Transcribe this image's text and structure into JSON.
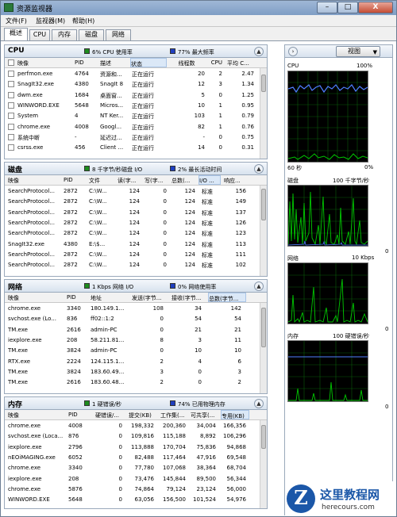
{
  "window": {
    "title": "资源监视器",
    "min": "–",
    "max": "□",
    "close": "X"
  },
  "menu": [
    "文件(F)",
    "监视器(M)",
    "帮助(H)"
  ],
  "tabs": [
    "概述",
    "CPU",
    "内存",
    "磁盘",
    "网络"
  ],
  "colors": {
    "green": "#1e8c1e",
    "blue": "#1f3fbf",
    "graph_green": "#00c800",
    "graph_blue": "#4f7fff"
  },
  "cpu": {
    "title": "CPU",
    "stat1": "6% CPU 使用率",
    "stat2": "77% 最大频率",
    "headers": [
      "映像",
      "PID",
      "描述",
      "状态",
      "线程数",
      "CPU",
      "平均 C..."
    ],
    "rows": [
      [
        "perfmon.exe",
        "4764",
        "资源和...",
        "正在运行",
        "20",
        "2",
        "2.47"
      ],
      [
        "SnagIt32.exe",
        "4380",
        "SnagIt 8",
        "正在运行",
        "12",
        "3",
        "1.34"
      ],
      [
        "dwm.exe",
        "1684",
        "桌面窗...",
        "正在运行",
        "5",
        "0",
        "1.25"
      ],
      [
        "WINWORD.EXE",
        "5648",
        "Micros...",
        "正在运行",
        "10",
        "1",
        "0.95"
      ],
      [
        "System",
        "4",
        "NT Ker...",
        "正在运行",
        "103",
        "1",
        "0.79"
      ],
      [
        "chrome.exe",
        "4008",
        "Googl...",
        "正在运行",
        "82",
        "1",
        "0.76"
      ],
      [
        "系统中断",
        "-",
        "延迟过...",
        "正在运行",
        "-",
        "0",
        "0.75"
      ],
      [
        "csrss.exe",
        "456",
        "Client ...",
        "正在运行",
        "14",
        "0",
        "0.31"
      ]
    ]
  },
  "disk": {
    "title": "磁盘",
    "stat1": "8 千字节/秒磁盘 I/O",
    "stat2": "2% 最长活动时间",
    "headers": [
      "映像",
      "PID",
      "文件",
      "读(字...",
      "写(字...",
      "总数(...",
      "I/O ...",
      "响应..."
    ],
    "rows": [
      [
        "SearchProtocol...",
        "2872",
        "C:\\W...",
        "124",
        "0",
        "124",
        "标准",
        "156"
      ],
      [
        "SearchProtocol...",
        "2872",
        "C:\\W...",
        "124",
        "0",
        "124",
        "标准",
        "149"
      ],
      [
        "SearchProtocol...",
        "2872",
        "C:\\W...",
        "124",
        "0",
        "124",
        "标准",
        "137"
      ],
      [
        "SearchProtocol...",
        "2872",
        "C:\\W...",
        "124",
        "0",
        "124",
        "标准",
        "126"
      ],
      [
        "SearchProtocol...",
        "2872",
        "C:\\W...",
        "124",
        "0",
        "124",
        "标准",
        "123"
      ],
      [
        "SnagIt32.exe",
        "4380",
        "E:\\$...",
        "124",
        "0",
        "124",
        "标准",
        "113"
      ],
      [
        "SearchProtocol...",
        "2872",
        "C:\\W...",
        "124",
        "0",
        "124",
        "标准",
        "111"
      ],
      [
        "SearchProtocol...",
        "2872",
        "C:\\W...",
        "124",
        "0",
        "124",
        "标准",
        "102"
      ]
    ]
  },
  "network": {
    "title": "网络",
    "stat1": "1 Kbps 网络 I/O",
    "stat2": "0% 网络使用率",
    "headers": [
      "映像",
      "PID",
      "地址",
      "发送(字节...",
      "接收(字节...",
      "总数(字节..."
    ],
    "rows": [
      [
        "chrome.exe",
        "3340",
        "180.149.1...",
        "108",
        "34",
        "142"
      ],
      [
        "svchost.exe (Lo...",
        "836",
        "ff02::1:2",
        "0",
        "54",
        "54"
      ],
      [
        "TM.exe",
        "2616",
        "admin-PC",
        "0",
        "21",
        "21"
      ],
      [
        "iexplore.exe",
        "208",
        "58.211.81...",
        "8",
        "3",
        "11"
      ],
      [
        "TM.exe",
        "3824",
        "admin-PC",
        "0",
        "10",
        "10"
      ],
      [
        "RTX.exe",
        "2224",
        "124.115.1...",
        "2",
        "4",
        "6"
      ],
      [
        "TM.exe",
        "3824",
        "183.60.49...",
        "3",
        "0",
        "3"
      ],
      [
        "TM.exe",
        "2616",
        "183.60.48...",
        "2",
        "0",
        "2"
      ]
    ]
  },
  "memory": {
    "title": "内存",
    "stat1": "1 硬错误/秒",
    "stat2": "74% 已用物理内存",
    "headers": [
      "映像",
      "PID",
      "硬错误/...",
      "提交(KB)",
      "工作集(...",
      "可共享(...",
      "专用(KB)"
    ],
    "rows": [
      [
        "chrome.exe",
        "4008",
        "0",
        "198,332",
        "200,360",
        "34,004",
        "166,356"
      ],
      [
        "svchost.exe (Loca...",
        "876",
        "0",
        "109,816",
        "115,188",
        "8,892",
        "106,296"
      ],
      [
        "iexplore.exe",
        "2796",
        "0",
        "113,888",
        "170,704",
        "75,836",
        "94,868"
      ],
      [
        "nEOiMAGING.exe",
        "6052",
        "0",
        "82,488",
        "117,464",
        "47,916",
        "69,548"
      ],
      [
        "chrome.exe",
        "3340",
        "0",
        "77,780",
        "107,068",
        "38,364",
        "68,704"
      ],
      [
        "iexplore.exe",
        "208",
        "0",
        "73,476",
        "145,844",
        "89,500",
        "56,344"
      ],
      [
        "chrome.exe",
        "5876",
        "0",
        "74,864",
        "79,124",
        "23,124",
        "56,000"
      ],
      [
        "WINWORD.EXE",
        "5648",
        "0",
        "63,056",
        "156,500",
        "101,524",
        "54,976"
      ]
    ]
  },
  "right": {
    "nav": "›",
    "view_label": "视图",
    "view_arrow": "▼",
    "graphs": [
      {
        "name": "CPU",
        "right_label": "100%",
        "bottom_left": "60 秒",
        "bottom_right": "0%"
      },
      {
        "name": "磁盘",
        "right_label": "100 千字节/秒",
        "bottom_left": "",
        "bottom_right": "0"
      },
      {
        "name": "网络",
        "right_label": "10 Kbps",
        "bottom_left": "",
        "bottom_right": "0"
      },
      {
        "name": "内存",
        "right_label": "100 硬错误/秒",
        "bottom_left": "",
        "bottom_right": "0"
      }
    ]
  },
  "logo": {
    "mark": "Z",
    "name": "这里教程网",
    "url": "herecours.com"
  }
}
